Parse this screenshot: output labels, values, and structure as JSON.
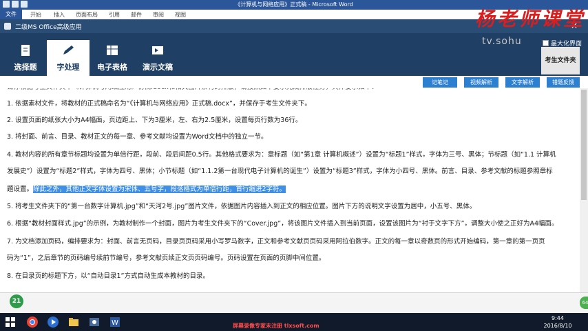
{
  "word": {
    "title": "《计算机与网络应用》正式稿 - Microsoft Word",
    "tabs": [
      "文件",
      "开始",
      "插入",
      "页面布局",
      "引用",
      "邮件",
      "审阅",
      "视图"
    ]
  },
  "watermark": {
    "logo": "杨老师课堂",
    "site": "tv.sohu"
  },
  "app": {
    "title": "二级MS Office高级应用",
    "close": "×",
    "nav": [
      "选择题",
      "字处理",
      "电子表格",
      "演示文稿"
    ],
    "active_nav": "字处理",
    "maximize_label": "最大化界面",
    "student_folder": "考生文件夹",
    "actions": [
      "记笔记",
      "视频解析",
      "文字解析",
      "错题反馈"
    ]
  },
  "content": {
    "top_partial": "请你根据考生文件夹下《计算机与网络应用》初稿.docx和相关图片素材的排版，请按照如下要求完成排版任务，具体要求如下：",
    "items": [
      "1. 依据素材文件，将教材的正式稿命名为“《计算机与网络应用》正式稿.docx”，并保存于考生文件夹下。",
      "2. 设置页面的纸张大小为A4幅面，页边距上、下为3厘米，左、右为2.5厘米，设置每页行数为36行。",
      "3. 将封面、前言、目录、教材正文的每一章、参考文献均设置为Word文档中的独立一节。"
    ],
    "item4_line1": "4. 教材内容的所有章节标题均设置为单倍行距，段前、段后间距0.5行。其他格式要求为：章标题（如“第1章  计算机概述”）设置为“标题1”样式，字体为三号、黑体；节标题（如“1.1  计算机",
    "item4_line2": "发展史”）设置为“标题2”样式，字体为四号、黑体；小节标题（如“1.1.2第一台现代电子计算机的诞生”）设置为“标题3”样式，字体为小四号、黑体。前言、目录、参考文献的标题参照章标",
    "item4_line3_plain": "题设置。",
    "item4_line3_highlight": "除此之外，其他正文字体设置为宋体、五号字，段落格式为单倍行距，首行缩进2字符。",
    "items_after": [
      "5. 将考生文件夹下的“第一台数字计算机.jpg”和“天河2号.jpg”图片文件，依据图片内容插入到正文的相应位置。图片下方的说明文字设置为居中，小五号、黑体。",
      "6. 根据“教材封面样式.jpg”的示例，为教材制作一个封面，图片为考生文件夹下的“Cover.jpg”，将该图片文件插入到当前页面，设置该图片为“衬于文字下方”，调整大小使之正好为A4幅面。",
      "7. 为文档添加页码，编排要求为：封面、前言无页码，目录页页码采用小写罗马数字，正文和参考文献页页码采用阿拉伯数字。正文的每一章以奇数页的形式开始编码，第一章的第一页页",
      "码为“1”，之后章节的页码编号续前节编号，参考文献页续正文页页码编号。页码设置在页面的页脚中间位置。",
      "8. 在目录页的标题下方，以“自动目录1”方式自动生成本教材的目录。"
    ]
  },
  "footer": {
    "page": "21",
    "badge": "64"
  },
  "taskbar": {
    "banner": "屏幕录像专家未注册 tlxsoft.com",
    "time": "9:44",
    "date": "2016/8/10"
  },
  "colors": {
    "nav_bg": "#1f3f64",
    "accent": "#2d7fd0",
    "highlight": "#3f8fe6",
    "word_blue": "#2b579a"
  }
}
